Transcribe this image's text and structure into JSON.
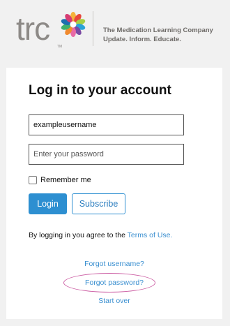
{
  "header": {
    "logo_text": "trc",
    "logo_tm": "TM",
    "tagline_line1": "The Medication Learning Company",
    "tagline_line2": "Update. Inform. Educate."
  },
  "login": {
    "title": "Log in to your account",
    "username_value": "exampleusername",
    "password_placeholder": "Enter your password",
    "remember_label": "Remember me",
    "login_button": "Login",
    "subscribe_button": "Subscribe",
    "agree_text": "By logging in you agree to the",
    "terms_link": "Terms of Use.",
    "forgot_username": "Forgot username?",
    "forgot_password": "Forgot password?",
    "start_over": "Start over"
  },
  "colors": {
    "accent": "#2d8fd1",
    "link": "#3a8fd0",
    "highlight_circle": "#cc5fa4"
  }
}
